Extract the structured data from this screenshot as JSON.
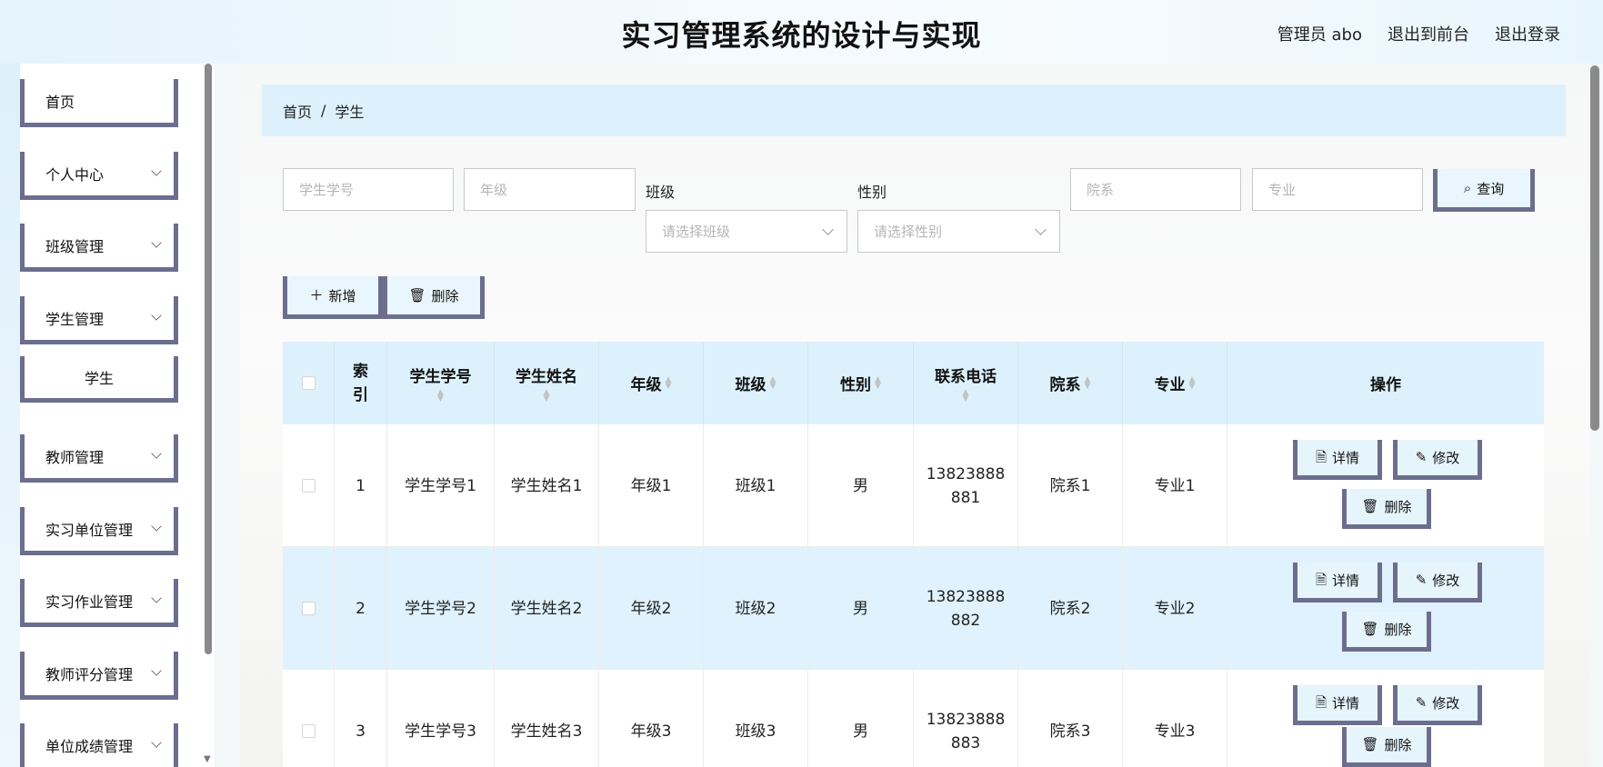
{
  "header": {
    "title": "实习管理系统的设计与实现",
    "user": "管理员 abo",
    "to_front": "退出到前台",
    "logout": "退出登录"
  },
  "sidebar": {
    "items": [
      {
        "label": "首页"
      },
      {
        "label": "个人中心"
      },
      {
        "label": "班级管理"
      },
      {
        "label": "学生管理"
      },
      {
        "label": "学生"
      },
      {
        "label": "教师管理"
      },
      {
        "label": "实习单位管理"
      },
      {
        "label": "实习作业管理"
      },
      {
        "label": "教师评分管理"
      },
      {
        "label": "单位成绩管理"
      }
    ]
  },
  "breadcrumb": {
    "home": "首页",
    "sep": "/",
    "current": "学生"
  },
  "search": {
    "student_no_placeholder": "学生学号",
    "grade_placeholder": "年级",
    "class_label": "班级",
    "class_placeholder": "请选择班级",
    "gender_label": "性别",
    "gender_placeholder": "请选择性别",
    "dept_placeholder": "院系",
    "major_placeholder": "专业",
    "query_label": "查询"
  },
  "toolbar": {
    "add_label": "新增",
    "delete_label": "删除"
  },
  "table": {
    "headers": {
      "index": "索引",
      "student_no": "学生学号",
      "student_name": "学生姓名",
      "grade": "年级",
      "class": "班级",
      "gender": "性别",
      "phone": "联系电话",
      "dept": "院系",
      "major": "专业",
      "ops": "操作"
    },
    "rows": [
      {
        "index": "1",
        "student_no": "学生学号1",
        "student_name": "学生姓名1",
        "grade": "年级1",
        "class": "班级1",
        "gender": "男",
        "phone_a": "13823888",
        "phone_b": "881",
        "dept": "院系1",
        "major": "专业1"
      },
      {
        "index": "2",
        "student_no": "学生学号2",
        "student_name": "学生姓名2",
        "grade": "年级2",
        "class": "班级2",
        "gender": "男",
        "phone_a": "13823888",
        "phone_b": "882",
        "dept": "院系2",
        "major": "专业2"
      },
      {
        "index": "3",
        "student_no": "学生学号3",
        "student_name": "学生姓名3",
        "grade": "年级3",
        "class": "班级3",
        "gender": "男",
        "phone_a": "13823888",
        "phone_b": "883",
        "dept": "院系3",
        "major": "专业3"
      }
    ],
    "ops": {
      "detail": "详情",
      "edit": "修改",
      "delete": "删除"
    }
  },
  "icons": {
    "search": "search-icon",
    "add": "plus-icon",
    "delete": "trash-icon",
    "detail": "document-icon",
    "edit": "pencil-icon",
    "chevron": "chevron-down-icon"
  },
  "colors": {
    "accent_border": "#6c6e8e",
    "header_bg": "#e4f3fc",
    "row_highlight": "#dff2fd"
  }
}
